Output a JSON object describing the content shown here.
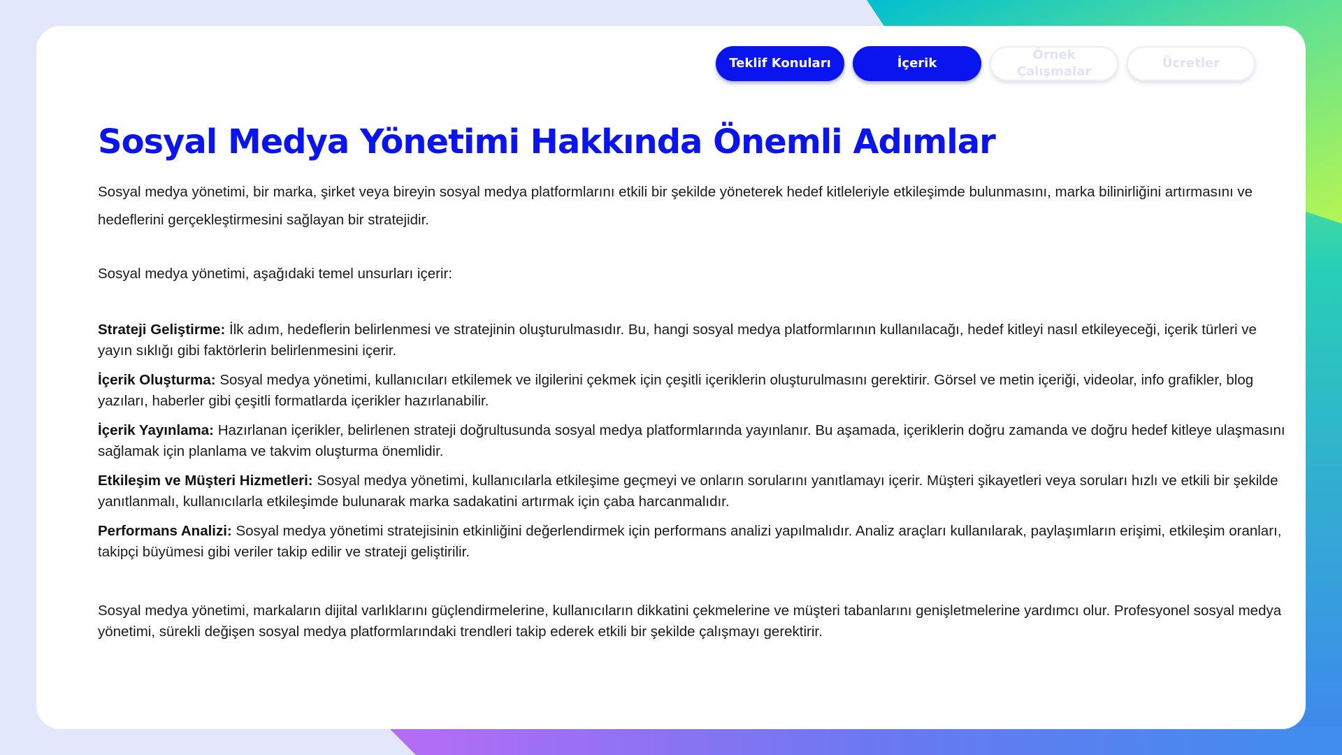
{
  "nav": {
    "items": [
      {
        "label": "Teklif Konuları",
        "active": true
      },
      {
        "label": "İçerik",
        "active": true
      },
      {
        "label": "Örnek Çalışmalar",
        "active": false
      },
      {
        "label": "Ücretler",
        "active": false
      }
    ]
  },
  "page": {
    "title": "Sosyal Medya Yönetimi Hakkında Önemli Adımlar",
    "intro": "Sosyal medya yönetimi, bir marka, şirket veya bireyin sosyal medya platformlarını etkili bir şekilde yöneterek hedef kitleleriyle etkileşimde bulunmasını, marka bilinirliğini artırmasını ve hedeflerini gerçekleştirmesini sağlayan bir stratejidir.",
    "lead": "Sosyal medya yönetimi, aşağıdaki temel unsurları içerir:",
    "items": [
      {
        "term": "Strateji Geliştirme:",
        "text": " İlk adım, hedeflerin belirlenmesi ve stratejinin oluşturulmasıdır. Bu, hangi sosyal medya platformlarının kullanılacağı, hedef kitleyi nasıl etkileyeceği, içerik türleri ve yayın sıklığı gibi faktörlerin belirlenmesini içerir."
      },
      {
        "term": "İçerik Oluşturma:",
        "text": " Sosyal medya yönetimi, kullanıcıları etkilemek ve ilgilerini çekmek için çeşitli içeriklerin oluşturulmasını gerektirir. Görsel ve metin içeriği, videolar, info grafikler, blog yazıları, haberler gibi çeşitli formatlarda içerikler hazırlanabilir."
      },
      {
        "term": "İçerik Yayınlama:",
        "text": " Hazırlanan içerikler, belirlenen strateji doğrultusunda sosyal medya platformlarında yayınlanır. Bu aşamada, içeriklerin doğru zamanda ve doğru hedef kitleye ulaşmasını sağlamak için planlama ve takvim oluşturma önemlidir."
      },
      {
        "term": "Etkileşim ve Müşteri Hizmetleri:",
        "text": " Sosyal medya yönetimi, kullanıcılarla etkileşime geçmeyi ve onların sorularını yanıtlamayı içerir. Müşteri şikayetleri veya soruları hızlı ve etkili bir şekilde yanıtlanmalı, kullanıcılarla etkileşimde bulunarak marka sadakatini artırmak için çaba harcanmalıdır."
      },
      {
        "term": "Performans Analizi:",
        "text": " Sosyal medya yönetimi stratejisinin etkinliğini değerlendirmek için performans analizi yapılmalıdır. Analiz araçları kullanılarak, paylaşımların erişimi, etkileşim oranları, takipçi büyümesi gibi veriler takip edilir ve strateji geliştirilir."
      }
    ],
    "closing": "Sosyal medya yönetimi, markaların dijital varlıklarını güçlendirmelerine, kullanıcıların dikkatini çekmelerine ve müşteri tabanlarını genişletmelerine yardımcı olur. Profesyonel sosyal medya yönetimi, sürekli değişen sosyal medya platformlarındaki trendleri takip ederek etkili bir şekilde çalışmayı gerektirir."
  },
  "colors": {
    "accent": "#0a14ee",
    "inactive_text": "#dfe3f3",
    "background": "#e3e7fb",
    "gradient_top_right": [
      "#00c2d0",
      "#a8f45a"
    ],
    "gradient_bottom": [
      "#b26cf4",
      "#3f8ff0"
    ]
  }
}
